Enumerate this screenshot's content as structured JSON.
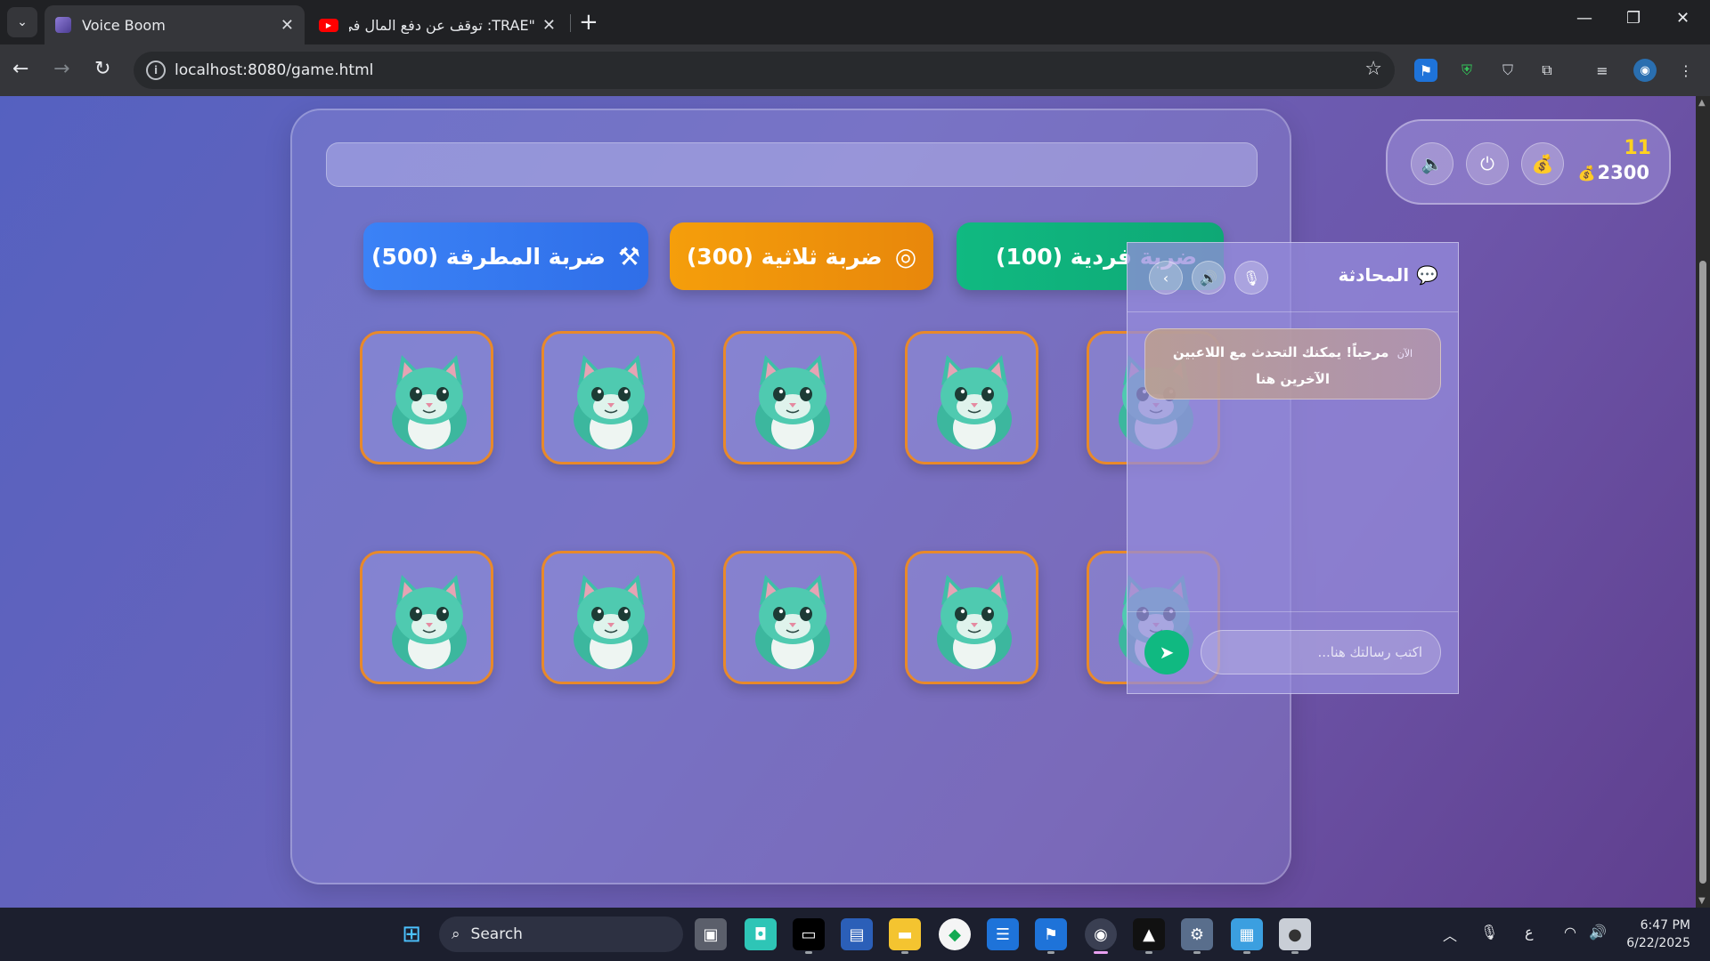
{
  "browser": {
    "tabs": [
      {
        "title": "Voice Boom",
        "active": true
      },
      {
        "title": "\"TRAE: توقف عن دفع المال في Cu",
        "active": false
      }
    ],
    "url": "localhost:8080/game.html"
  },
  "game": {
    "hud": {
      "level": "11",
      "coins": "2300"
    },
    "attacks": [
      {
        "label": "ضربة المطرقة (500)",
        "icon": "hammer-icon",
        "color": "#3b82f6"
      },
      {
        "label": "ضربة ثلاثية (300)",
        "icon": "target-icon",
        "color": "#f59e0b"
      },
      {
        "label": "ضربة فردية (100)",
        "icon": "none",
        "color": "#10b981"
      }
    ],
    "grid": {
      "rows": 2,
      "cols": 5,
      "card_image": "teal-cat-avatar",
      "border_color": "#e8892a"
    }
  },
  "chat": {
    "title": "المحادثة",
    "messages": [
      {
        "time": "الآن",
        "text": "مرحباً! يمكنك التحدث مع اللاعبين الآخرين هنا"
      }
    ],
    "input_placeholder": "اكتب رسالتك هنا..."
  },
  "taskbar": {
    "search_label": "Search",
    "lang": "ع",
    "time": "6:47 PM",
    "date": "6/22/2025"
  }
}
